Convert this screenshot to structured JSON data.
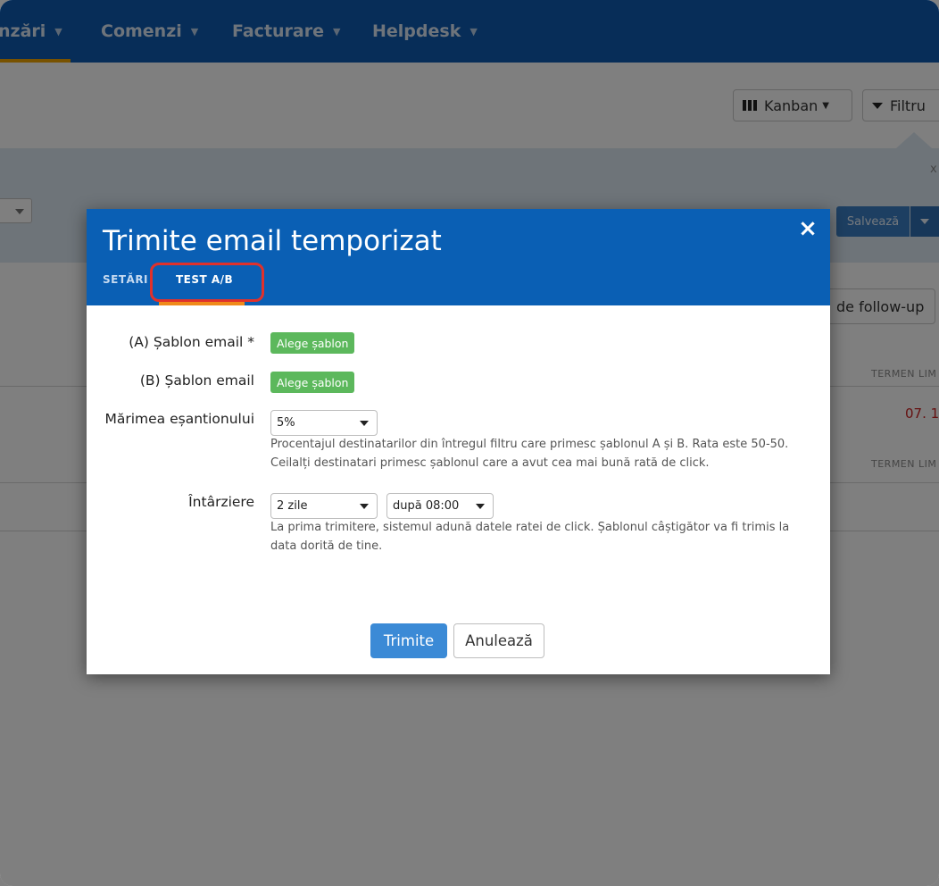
{
  "nav": {
    "items": [
      {
        "label": "nzări"
      },
      {
        "label": "Comenzi"
      },
      {
        "label": "Facturare"
      },
      {
        "label": "Helpdesk"
      }
    ]
  },
  "toolbar": {
    "kanban_label": "Kanban",
    "filter_label": "Filtru"
  },
  "filter_panel": {
    "close_label": "x",
    "save_label": "Salvează"
  },
  "list": {
    "followup_label": "de follow-up",
    "column_header": "TERMEN LIM",
    "deadline_value": "07. 1"
  },
  "modal": {
    "title": "Trimite email temporizat",
    "close_label": "×",
    "tabs": [
      {
        "label": "SETĂRI"
      },
      {
        "label": "TEST A/B"
      }
    ],
    "form": {
      "template_a_label": "(A) Șablon email *",
      "template_a_button": "Alege șablon",
      "template_b_label": "(B) Șablon email",
      "template_b_button": "Alege șablon",
      "sample_size_label": "Mărimea eșantionului",
      "sample_size_value": "5%",
      "sample_size_help_1": "Procentajul destinatarilor din întregul filtru care primesc șablonul A și B. Rata este 50-50.",
      "sample_size_help_2": "Ceilalți destinatari primesc șablonul care a avut cea mai bună rată de click.",
      "delay_label": "Întârziere",
      "delay_value": "2 zile",
      "delay_time_value": "după 08:00",
      "delay_help_1": "La prima trimitere, sistemul adună datele ratei de click. Șablonul câștigător va fi trimis la",
      "delay_help_2": "data dorită de tine."
    },
    "footer": {
      "submit_label": "Trimite",
      "cancel_label": "Anulează"
    }
  },
  "colors": {
    "header_blue": "#0a5fb4",
    "primary_button": "#3b8ad6",
    "green_button": "#5cb85c",
    "tab_underline": "#f08a1a",
    "highlight_red": "#e0312b"
  }
}
